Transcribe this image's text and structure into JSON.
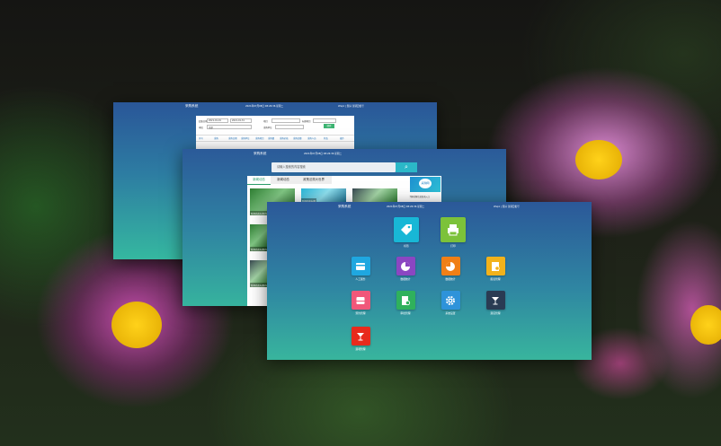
{
  "window1": {
    "title": "采购系统",
    "time": "2021年07月08日 08:26:36 星期二",
    "user": "Wsp1 | 您好   注销云帐号",
    "form": {
      "row1": [
        "起始日期",
        "2021-01-01",
        "2021-01-31",
        "项目",
        "标题项目"
      ],
      "row2": [
        "审批",
        "全部",
        "采购单位",
        "搜索"
      ]
    },
    "table_headers": [
      "序号",
      "采购",
      "采购日期",
      "采购单位",
      "采购项目",
      "采购量",
      "采购价格",
      "采购金额",
      "采购人员",
      "状态",
      "操作"
    ]
  },
  "window2": {
    "title": "采购系统",
    "time": "2021年07月08日 08:26:36 星期二",
    "search": {
      "placeholder": "请输入搜索的内容搜索"
    },
    "tabs": [
      "新闻动态",
      "新闻动态",
      "政策法规大世界"
    ],
    "news": [
      {
        "caption": "新闻动态标题内容"
      },
      {
        "caption": "新闻动态标题"
      },
      {
        "caption": ""
      },
      {
        "caption": "新闻动态标题内容"
      },
      {
        "caption": "新闻动态标题内容"
      }
    ],
    "sidebar": {
      "banner": "采购网",
      "link": "了解采购信息查询入口"
    }
  },
  "window3": {
    "title": "采购系统",
    "time": "2021年07月08日 08:26:36 星期二",
    "user": "Wsp1 | 您好   注销云帐号",
    "apps_row1": [
      {
        "label": "标签",
        "icon": "tag-icon",
        "color": "#18b7d6"
      },
      {
        "label": "打印",
        "icon": "printer-icon",
        "color": "#7cc23a"
      }
    ],
    "apps_row2": [
      {
        "label": "人工服务",
        "icon": "card-icon",
        "color": "#1fa7e0"
      },
      {
        "label": "数据统计",
        "icon": "pie-chart-icon",
        "color": "#8b46c2"
      },
      {
        "label": "数据统计",
        "icon": "pie-chart-icon",
        "color": "#f07f16"
      },
      {
        "label": "报表管理",
        "icon": "document-icon",
        "color": "#f2b21b"
      }
    ],
    "apps_row3": [
      {
        "label": "预约管理",
        "icon": "tray-icon",
        "color": "#f0577a"
      },
      {
        "label": "审批管理",
        "icon": "document-settings-icon",
        "color": "#2fb15c"
      },
      {
        "label": "系统设置",
        "icon": "gear-icon",
        "color": "#2e93da"
      },
      {
        "label": "酒店管理",
        "icon": "cocktail-icon",
        "color": "#2a3b53"
      }
    ],
    "apps_row4": [
      {
        "label": "酒吧管理",
        "icon": "cocktail-icon",
        "color": "#e82a1c"
      }
    ]
  }
}
